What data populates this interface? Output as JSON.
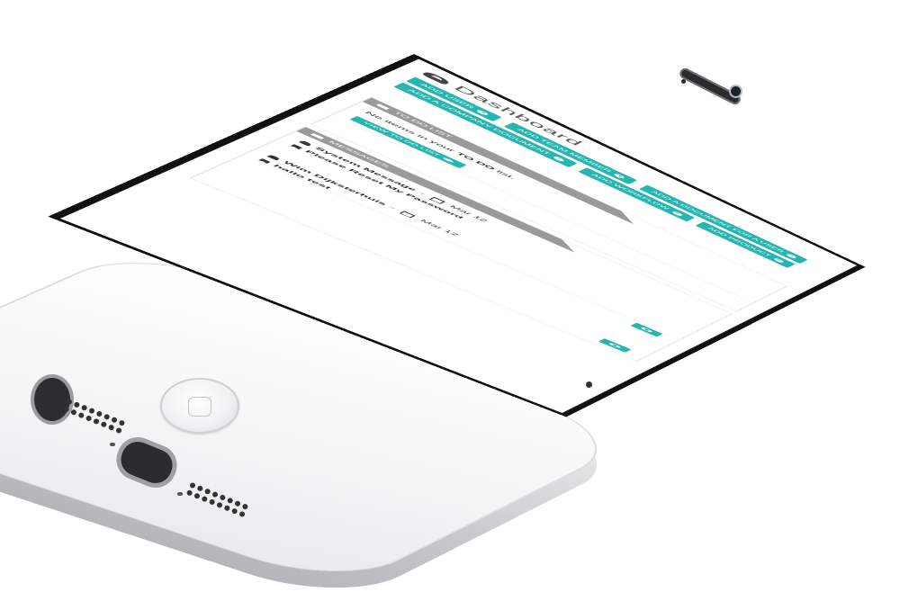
{
  "app": {
    "title": "Dashboard"
  },
  "actions": [
    {
      "label": "ADD USER",
      "icon": "plus-circle-icon"
    },
    {
      "label": "ADD TEAM MEMBER",
      "icon": "plus-circle-icon"
    },
    {
      "label": "ADD A DOCUMENT FOR A USER",
      "icon": "upload-icon"
    },
    {
      "label": "ADD A COMPANY DOCUMENT",
      "icon": "upload-icon"
    },
    {
      "label": "ADD WORKFLOW",
      "icon": "plus-circle-icon"
    },
    {
      "label": "ADD PRODUCT",
      "icon": "plus-circle-icon"
    }
  ],
  "todo": {
    "header": "TO DO LIST",
    "empty_prefix": "No items in your ",
    "empty_bold": "TO DO",
    "empty_suffix": " list.",
    "view_label": "VIEW TO DO LIST"
  },
  "messages": {
    "header": "MESSAGES",
    "items": [
      {
        "sender": "System Message",
        "sep": " - ",
        "date": "Mar 12",
        "icon": "user-icon"
      },
      {
        "subject": "Please Reset My Password",
        "icon": "bookmark-icon"
      },
      {
        "sender": "Wim Dijksterhuis",
        "sep": " - ",
        "date": "Mar 12",
        "icon": "user-icon"
      },
      {
        "subject": "hallo test",
        "icon": "bookmark-icon"
      }
    ]
  },
  "colors": {
    "accent": "#26b5b0",
    "panel_header": "#9a9a9a",
    "phone_body": "#f4f4f5",
    "phone_edge": "#c9cacd"
  }
}
